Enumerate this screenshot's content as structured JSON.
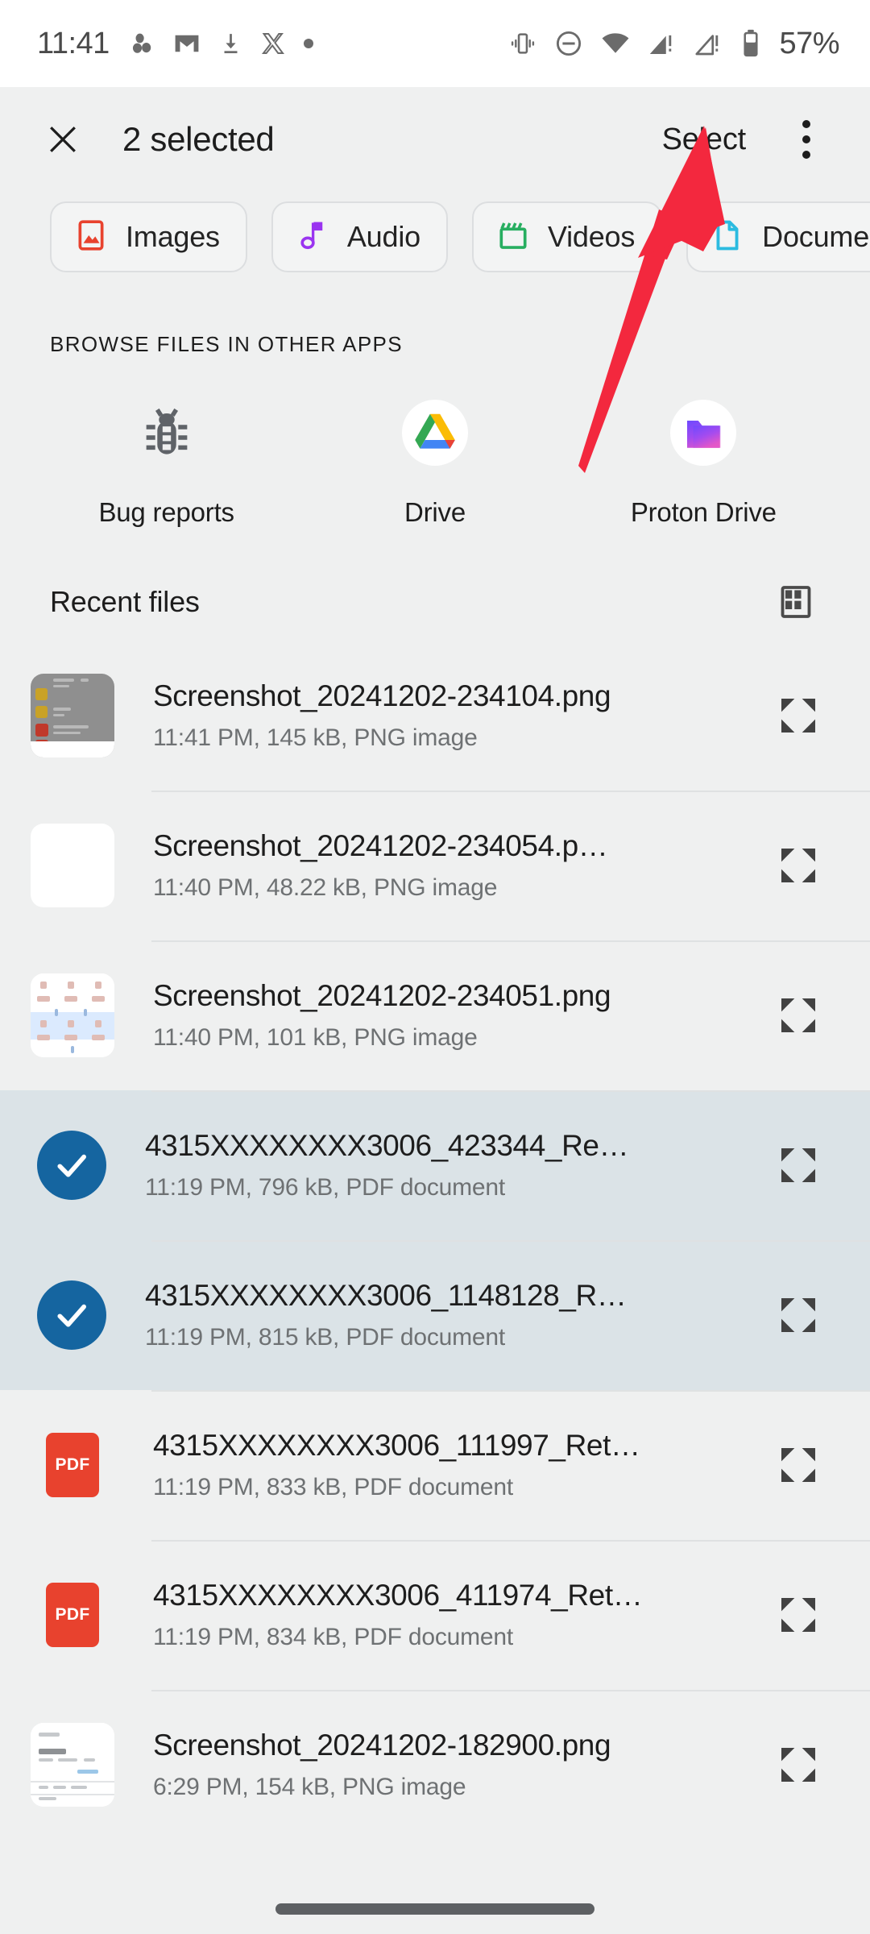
{
  "status_bar": {
    "time": "11:41",
    "battery_percent": "57%",
    "left_icons": [
      "contacts-icon",
      "gmail-icon",
      "download-icon",
      "x-twitter-icon",
      "dot-icon"
    ],
    "right_icons": [
      "vibrate-icon",
      "do-not-disturb-icon",
      "wifi-icon",
      "signal-sim1-alert-icon",
      "signal-sim2-alert-icon",
      "battery-icon"
    ]
  },
  "app_bar": {
    "close_label": "✕",
    "title": "2 selected",
    "select_label": "Select",
    "overflow_label": "More options"
  },
  "filter_chips": [
    {
      "label": "Images",
      "icon": "image-icon",
      "color": "#e8422e"
    },
    {
      "label": "Audio",
      "icon": "audio-icon",
      "color": "#9a34f0"
    },
    {
      "label": "Videos",
      "icon": "video-icon",
      "color": "#27ae60"
    },
    {
      "label": "Documents",
      "icon": "document-icon",
      "color": "#2bbbe0"
    }
  ],
  "browse_section": {
    "heading": "BROWSE FILES IN OTHER APPS",
    "apps": [
      {
        "label": "Bug reports",
        "icon": "bug-icon"
      },
      {
        "label": "Drive",
        "icon": "google-drive-icon"
      },
      {
        "label": "Proton Drive",
        "icon": "proton-drive-icon"
      }
    ]
  },
  "recent": {
    "title": "Recent files",
    "view_toggle_icon": "grid-view-icon",
    "files": [
      {
        "name": "Screenshot_20241202-234104.png",
        "meta": "11:41 PM, 145 kB, PNG image",
        "time": "11:41 PM",
        "size": "145 kB",
        "type": "PNG image",
        "selected": false,
        "thumb": "screenshot-thumb-a",
        "first": true
      },
      {
        "name": "Screenshot_20241202-234054.p…",
        "meta": "11:40 PM, 48.22 kB, PNG image",
        "time": "11:40 PM",
        "size": "48.22 kB",
        "type": "PNG image",
        "selected": false,
        "thumb": "screenshot-thumb-blank",
        "first": false
      },
      {
        "name": "Screenshot_20241202-234051.png",
        "meta": "11:40 PM, 101 kB, PNG image",
        "time": "11:40 PM",
        "size": "101 kB",
        "type": "PNG image",
        "selected": false,
        "thumb": "screenshot-thumb-c",
        "first": false
      },
      {
        "name": "4315XXXXXXXX3006_423344_Re…",
        "meta": "11:19 PM, 796 kB, PDF document",
        "time": "11:19 PM",
        "size": "796 kB",
        "type": "PDF document",
        "selected": true,
        "thumb": "check-icon",
        "first": false
      },
      {
        "name": "4315XXXXXXXX3006_1148128_R…",
        "meta": "11:19 PM, 815 kB, PDF document",
        "time": "11:19 PM",
        "size": "815 kB",
        "type": "PDF document",
        "selected": true,
        "thumb": "check-icon",
        "first": false
      },
      {
        "name": "4315XXXXXXXX3006_111997_Ret…",
        "meta": "11:19 PM, 833 kB, PDF document",
        "time": "11:19 PM",
        "size": "833 kB",
        "type": "PDF document",
        "selected": false,
        "thumb": "pdf-icon",
        "first": false
      },
      {
        "name": "4315XXXXXXXX3006_411974_Ret…",
        "meta": "11:19 PM, 834 kB, PDF document",
        "time": "11:19 PM",
        "size": "834 kB",
        "type": "PDF document",
        "selected": false,
        "thumb": "pdf-icon",
        "first": false
      },
      {
        "name": "Screenshot_20241202-182900.png",
        "meta": "6:29 PM, 154 kB, PNG image",
        "time": "6:29 PM",
        "size": "154 kB",
        "type": "PNG image",
        "selected": false,
        "thumb": "screenshot-thumb-d",
        "first": false
      }
    ],
    "pdf_tile_label": "PDF"
  },
  "annotation": {
    "arrow_color": "#f3283e",
    "points_to": "Select"
  },
  "colors": {
    "background": "#eff0f0",
    "status_bar_bg": "#ffffff",
    "selected_row": "#dbe3e7",
    "check_blue": "#1565a0",
    "pdf_red": "#e8422e",
    "text_primary": "#1d1d1d",
    "text_secondary": "#6e7173"
  }
}
